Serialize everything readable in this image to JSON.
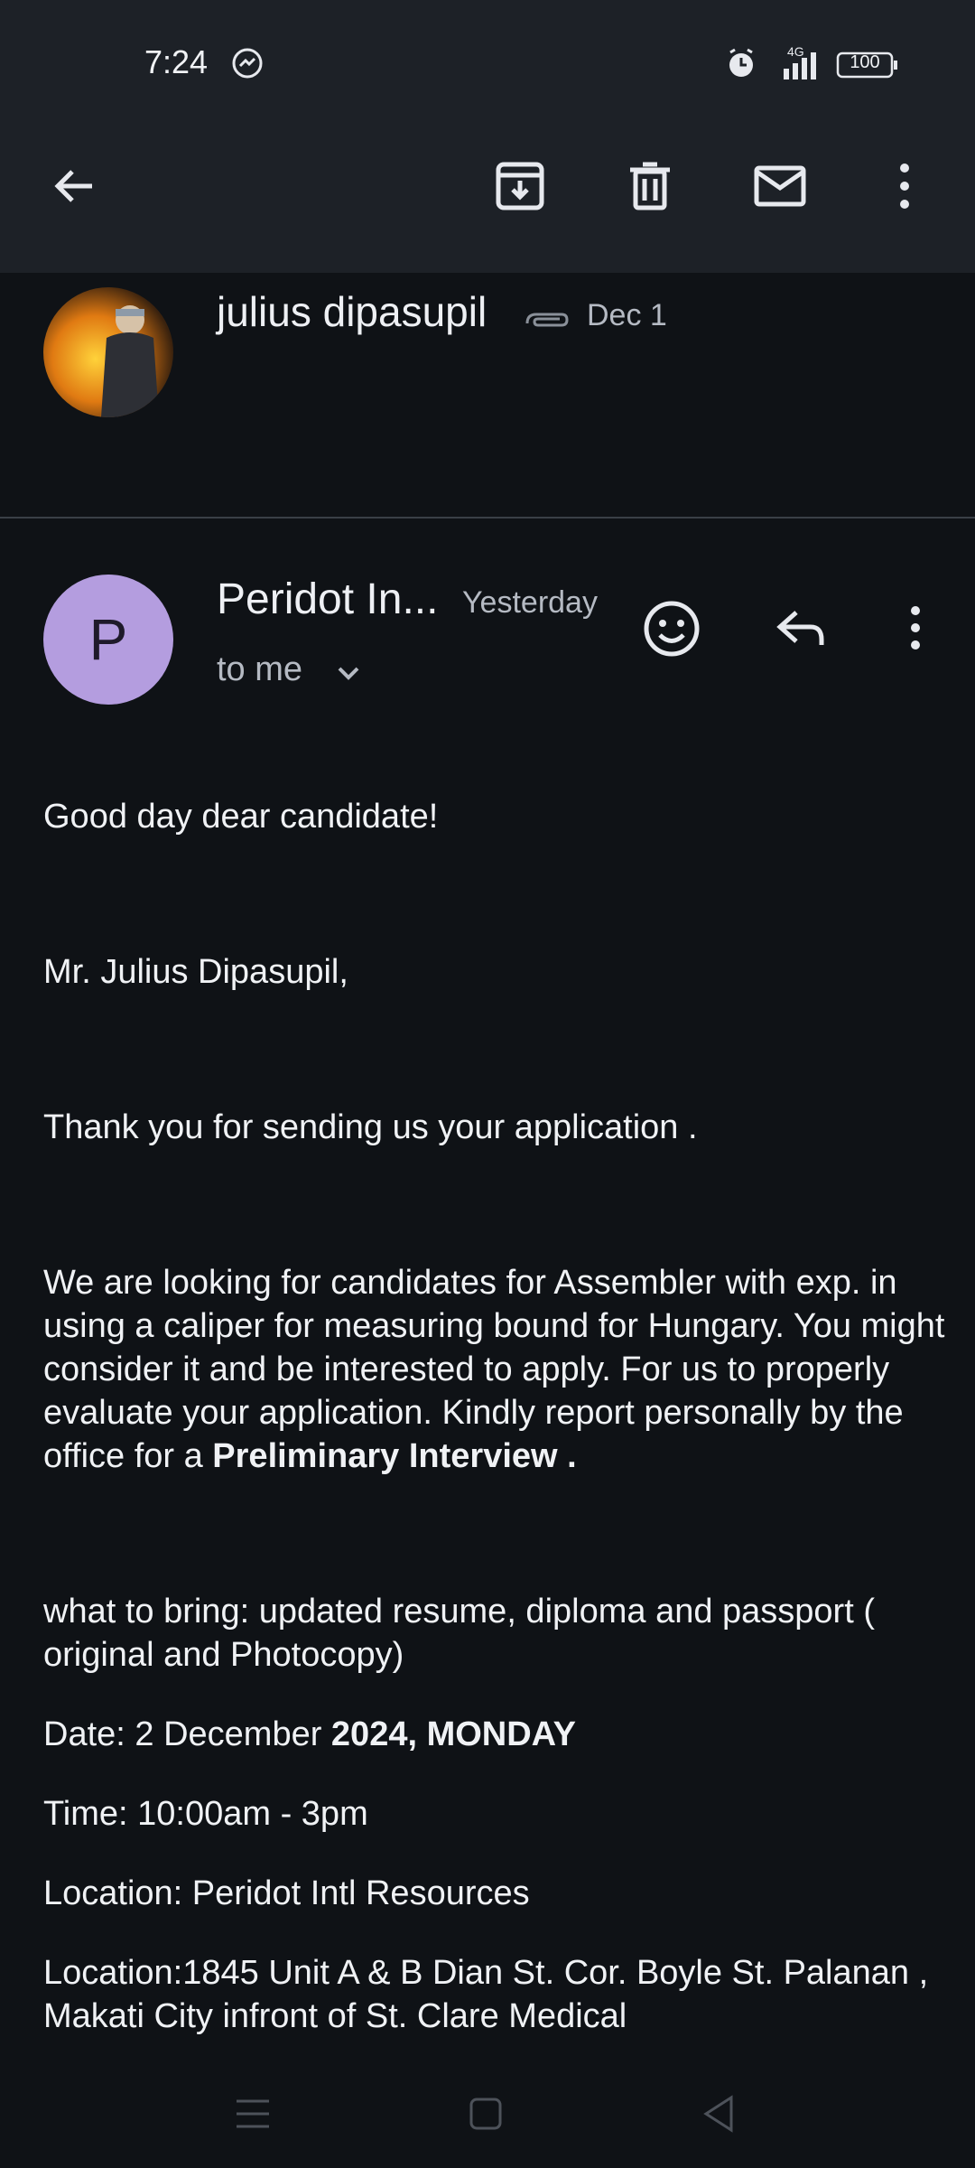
{
  "status": {
    "time": "7:24",
    "battery": "100",
    "network": "4G"
  },
  "toolbar": {
    "icons": [
      "back-arrow-icon",
      "archive-icon",
      "trash-icon",
      "mail-icon",
      "more-vertical-icon"
    ]
  },
  "previous_message": {
    "sender": "julius dipasupil",
    "date": "Dec 1",
    "has_attachment": true
  },
  "current_message": {
    "sender": "Peridot In...",
    "date": "Yesterday",
    "avatar_letter": "P",
    "to": "to me",
    "avatar_color": "#b49ddf"
  },
  "body": {
    "greeting": "Good day dear candidate!",
    "salutation": "Mr. Julius Dipasupil,",
    "thanks": "Thank you for sending us your application .",
    "para_main": "We are looking for candidates for Assembler with exp. in using a caliper for measuring bound for Hungary. You might consider it and be interested to apply. For us to properly evaluate your application. Kindly report personally by the office  for a ",
    "para_bold": "Preliminary Interview .",
    "bring": "what to bring: updated resume, diploma and passport ( original and Photocopy)",
    "date_label": "Date: 2 December ",
    "date_bold": "2024, MONDAY",
    "time": "Time: 10:00am - 3pm",
    "location1": "Location: Peridot Intl Resources",
    "location2": "Location:1845 Unit A & B Dian St. Cor. Boyle St. Palanan , Makati City infront of St. Clare Medical"
  },
  "colors": {
    "background": "#0f1216",
    "bar": "#1d2127",
    "text": "#f0f2f5",
    "muted": "#b5bac3"
  }
}
